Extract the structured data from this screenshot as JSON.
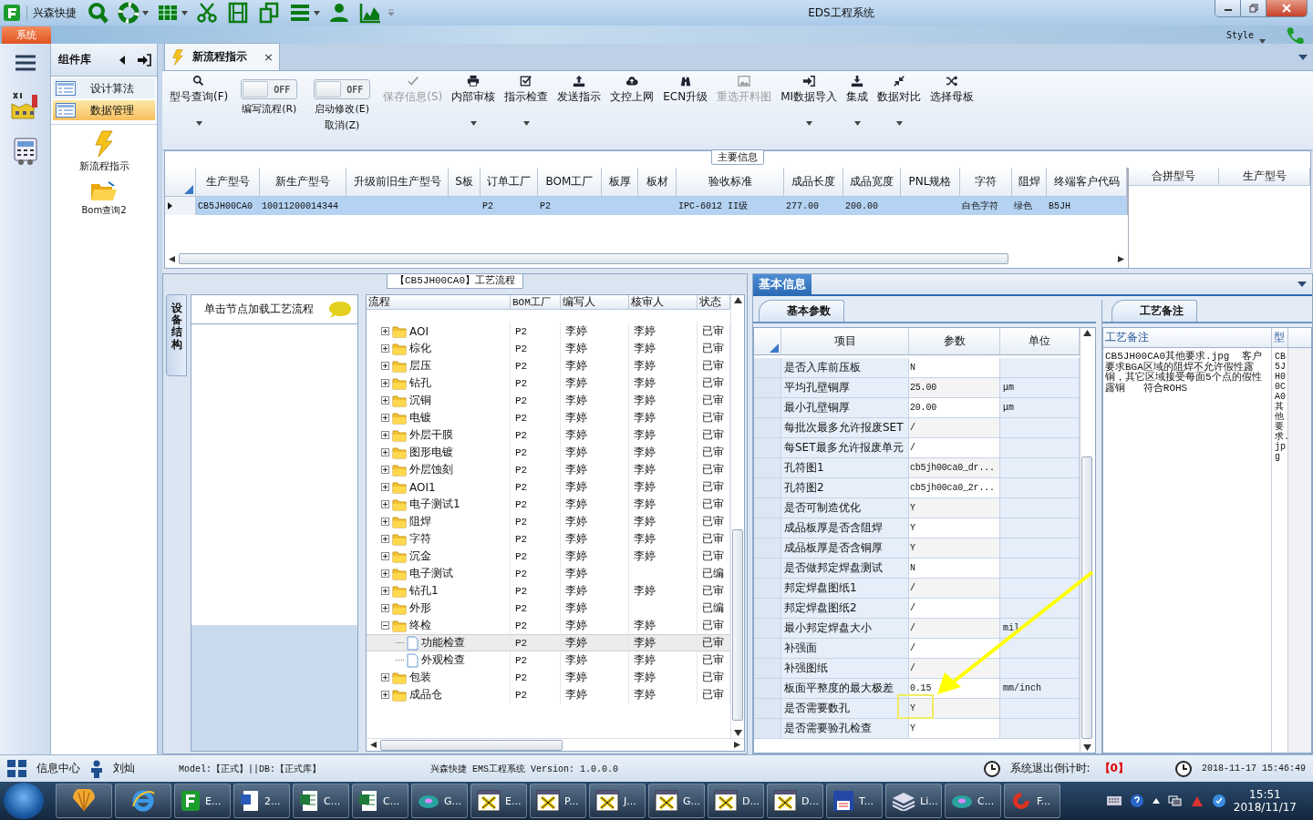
{
  "title_bar": {
    "app_name": "兴森快捷",
    "title": "EDS工程系统"
  },
  "ribbon": {
    "tab": "系统",
    "style_label": "Style"
  },
  "component_panel": {
    "title": "组件库",
    "items": [
      {
        "label": "设计算法",
        "selected": false
      },
      {
        "label": "数据管理",
        "selected": true
      }
    ],
    "tools": [
      "新流程指示",
      "Bom查询2"
    ]
  },
  "document_tab": {
    "label": "新流程指示",
    "close": "×"
  },
  "toolbar": [
    {
      "kind": "button",
      "label": "型号查询(F)",
      "dropdown": true,
      "disabled": false
    },
    {
      "kind": "toggle",
      "label": "编写流程(R)",
      "switch_text": "OFF",
      "on": false
    },
    {
      "kind": "toggle",
      "label": "启动修改(E)",
      "label2": "取消(Z)",
      "switch_text": "OFF",
      "on": false
    },
    {
      "kind": "button",
      "label": "保存信息(S)",
      "dropdown": false,
      "disabled": true
    },
    {
      "kind": "button",
      "label": "内部审核",
      "dropdown": true,
      "disabled": false
    },
    {
      "kind": "button",
      "label": "指示检查",
      "dropdown": true,
      "disabled": false
    },
    {
      "kind": "button",
      "label": "发送指示",
      "dropdown": false,
      "disabled": false
    },
    {
      "kind": "button",
      "label": "文控上网",
      "dropdown": false,
      "disabled": false
    },
    {
      "kind": "button",
      "label": "ECN升级",
      "dropdown": false,
      "disabled": false
    },
    {
      "kind": "button",
      "label": "重选开料图",
      "dropdown": false,
      "disabled": true
    },
    {
      "kind": "button",
      "label": "MI数据导入",
      "dropdown": true,
      "disabled": false
    },
    {
      "kind": "button",
      "label": "集成",
      "dropdown": true,
      "disabled": false
    },
    {
      "kind": "button",
      "label": "数据对比",
      "dropdown": true,
      "disabled": false
    },
    {
      "kind": "button",
      "label": "选择母板",
      "dropdown": false,
      "disabled": false
    }
  ],
  "main_info": {
    "title": "主要信息",
    "columns": [
      "生产型号",
      "新生产型号",
      "升级前旧生产型号",
      "S板",
      "订单工厂",
      "BOM工厂",
      "板厚",
      "板材",
      "验收标准",
      "成品长度",
      "成品宽度",
      "PNL规格",
      "字符",
      "阻焊",
      "终端客户代码"
    ],
    "rows": [
      {
        "selected": true,
        "cells": [
          "CB5JH00CA0",
          "10011200014344",
          null,
          null,
          "P2",
          "P2",
          null,
          null,
          "IPC-6012 II级",
          "277.00",
          "200.00",
          null,
          "白色字符",
          "绿色",
          "B5JH"
        ]
      }
    ]
  },
  "merge_table": {
    "columns": [
      "合拼型号",
      "生产型号"
    ]
  },
  "process": {
    "title": "【CB5JH00CA0】工艺流程",
    "side_tab": "设备结构",
    "hint": "单击节点加载工艺流程",
    "columns": [
      "流程",
      "BOM工厂",
      "编写人",
      "核审人",
      "状态"
    ],
    "rows": [
      {
        "kind": "folder",
        "name": "AOI",
        "bom": "P2",
        "writer": "李婷",
        "reviewer": "李婷",
        "status": "已审",
        "expanded": false,
        "selected": false
      },
      {
        "kind": "folder",
        "name": "棕化",
        "bom": "P2",
        "writer": "李婷",
        "reviewer": "李婷",
        "status": "已审",
        "expanded": false,
        "selected": false
      },
      {
        "kind": "folder",
        "name": "层压",
        "bom": "P2",
        "writer": "李婷",
        "reviewer": "李婷",
        "status": "已审",
        "expanded": false,
        "selected": false
      },
      {
        "kind": "folder",
        "name": "钻孔",
        "bom": "P2",
        "writer": "李婷",
        "reviewer": "李婷",
        "status": "已审",
        "expanded": false,
        "selected": false
      },
      {
        "kind": "folder",
        "name": "沉铜",
        "bom": "P2",
        "writer": "李婷",
        "reviewer": "李婷",
        "status": "已审",
        "expanded": false,
        "selected": false
      },
      {
        "kind": "folder",
        "name": "电镀",
        "bom": "P2",
        "writer": "李婷",
        "reviewer": "李婷",
        "status": "已审",
        "expanded": false,
        "selected": false
      },
      {
        "kind": "folder",
        "name": "外层干膜",
        "bom": "P2",
        "writer": "李婷",
        "reviewer": "李婷",
        "status": "已审",
        "expanded": false,
        "selected": false
      },
      {
        "kind": "folder",
        "name": "图形电镀",
        "bom": "P2",
        "writer": "李婷",
        "reviewer": "李婷",
        "status": "已审",
        "expanded": false,
        "selected": false
      },
      {
        "kind": "folder",
        "name": "外层蚀刻",
        "bom": "P2",
        "writer": "李婷",
        "reviewer": "李婷",
        "status": "已审",
        "expanded": false,
        "selected": false
      },
      {
        "kind": "folder",
        "name": "AOI1",
        "bom": "P2",
        "writer": "李婷",
        "reviewer": "李婷",
        "status": "已审",
        "expanded": false,
        "selected": false
      },
      {
        "kind": "folder",
        "name": "电子测试1",
        "bom": "P2",
        "writer": "李婷",
        "reviewer": "李婷",
        "status": "已审",
        "expanded": false,
        "selected": false
      },
      {
        "kind": "folder",
        "name": "阻焊",
        "bom": "P2",
        "writer": "李婷",
        "reviewer": "李婷",
        "status": "已审",
        "expanded": false,
        "selected": false
      },
      {
        "kind": "folder",
        "name": "字符",
        "bom": "P2",
        "writer": "李婷",
        "reviewer": "李婷",
        "status": "已审",
        "expanded": false,
        "selected": false
      },
      {
        "kind": "folder",
        "name": "沉金",
        "bom": "P2",
        "writer": "李婷",
        "reviewer": "李婷",
        "status": "已审",
        "expanded": false,
        "selected": false
      },
      {
        "kind": "folder",
        "name": "电子测试",
        "bom": "P2",
        "writer": "李婷",
        "status": "已编",
        "expanded": false,
        "selected": false
      },
      {
        "kind": "folder",
        "name": "钻孔1",
        "bom": "P2",
        "writer": "李婷",
        "reviewer": "李婷",
        "status": "已审",
        "expanded": false,
        "selected": false
      },
      {
        "kind": "folder",
        "name": "外形",
        "bom": "P2",
        "writer": "李婷",
        "status": "已编",
        "expanded": false,
        "selected": false
      },
      {
        "kind": "folder",
        "name": "终检",
        "bom": "P2",
        "writer": "李婷",
        "reviewer": "李婷",
        "status": "已审",
        "expanded": true,
        "selected": false,
        "children": [
          {
            "kind": "file",
            "name": "功能检查",
            "bom": "P2",
            "writer": "李婷",
            "reviewer": "李婷",
            "status": "已审",
            "selected": true
          },
          {
            "kind": "file",
            "name": "外观检查",
            "bom": "P2",
            "writer": "李婷",
            "reviewer": "李婷",
            "status": "已审",
            "selected": false
          }
        ]
      },
      {
        "kind": "folder",
        "name": "包装",
        "bom": "P2",
        "writer": "李婷",
        "reviewer": "李婷",
        "status": "已审",
        "expanded": false,
        "selected": false
      },
      {
        "kind": "folder",
        "name": "成品仓",
        "bom": "P2",
        "writer": "李婷",
        "reviewer": "李婷",
        "status": "已审",
        "expanded": false,
        "selected": false
      }
    ]
  },
  "basic_info": {
    "tab": "基本信息",
    "sub_tab": "基本参数",
    "columns": [
      "项目",
      "参数",
      "单位"
    ],
    "rows": [
      {
        "item": "是否入库前压板",
        "value": "N"
      },
      {
        "item": "平均孔壁铜厚",
        "value": "25.00",
        "unit": "μm"
      },
      {
        "item": "最小孔壁铜厚",
        "value": "20.00",
        "unit": "μm"
      },
      {
        "item": "每批次最多允许报废SET",
        "value": "/"
      },
      {
        "item": "每SET最多允许报废单元",
        "value": "/"
      },
      {
        "item": "孔符图1",
        "value": "cb5jh00ca0_dr..."
      },
      {
        "item": "孔符图2",
        "value": "cb5jh00ca0_2r..."
      },
      {
        "item": "是否可制造优化",
        "value": "Y"
      },
      {
        "item": "成品板厚是否含阻焊",
        "value": "Y"
      },
      {
        "item": "成品板厚是否含铜厚",
        "value": "Y"
      },
      {
        "item": "是否做邦定焊盘测试",
        "value": "N"
      },
      {
        "item": "邦定焊盘图纸1",
        "value": "/"
      },
      {
        "item": "邦定焊盘图纸2",
        "value": "/"
      },
      {
        "item": "最小邦定焊盘大小",
        "value": "/",
        "unit": "mil"
      },
      {
        "item": "补强面",
        "value": "/"
      },
      {
        "item": "补强图纸",
        "value": "/"
      },
      {
        "item": "板面平整度的最大极差",
        "value": "0.15",
        "unit": "mm/inch"
      },
      {
        "item": "是否需要数孔",
        "value": "Y"
      },
      {
        "item": "是否需要验孔检查",
        "value": "Y"
      }
    ]
  },
  "notes": {
    "tab": "工艺备注",
    "columns": [
      "工艺备注",
      "型"
    ],
    "text": "CB5JH00CA0其他要求.jpg  客户要求BGA区域的阻焊不允许假性露铜，其它区域接受每面5个点的假性露铜   符合ROHS",
    "vertical_text": "CB5JH00CA0其他要求.jpg"
  },
  "status_bar": {
    "info_center": "信息中心",
    "user": "刘灿",
    "db_info": "Model:【正式】||DB:【正式库】",
    "version": "兴森快捷 EMS工程系统 Version: 1.0.0.0",
    "countdown_label": "系统退出倒计时:",
    "countdown": "【0】",
    "datetime": "2018-11-17 15:46:49"
  },
  "taskbar": {
    "items": [
      "E...",
      "2...",
      "C...",
      "C...",
      "G...",
      "E...",
      "P...",
      "J...",
      "G...",
      "D...",
      "D...",
      "T...",
      "Li...",
      "C...",
      "F..."
    ],
    "time": "15:51",
    "date": "2018/11/17"
  }
}
